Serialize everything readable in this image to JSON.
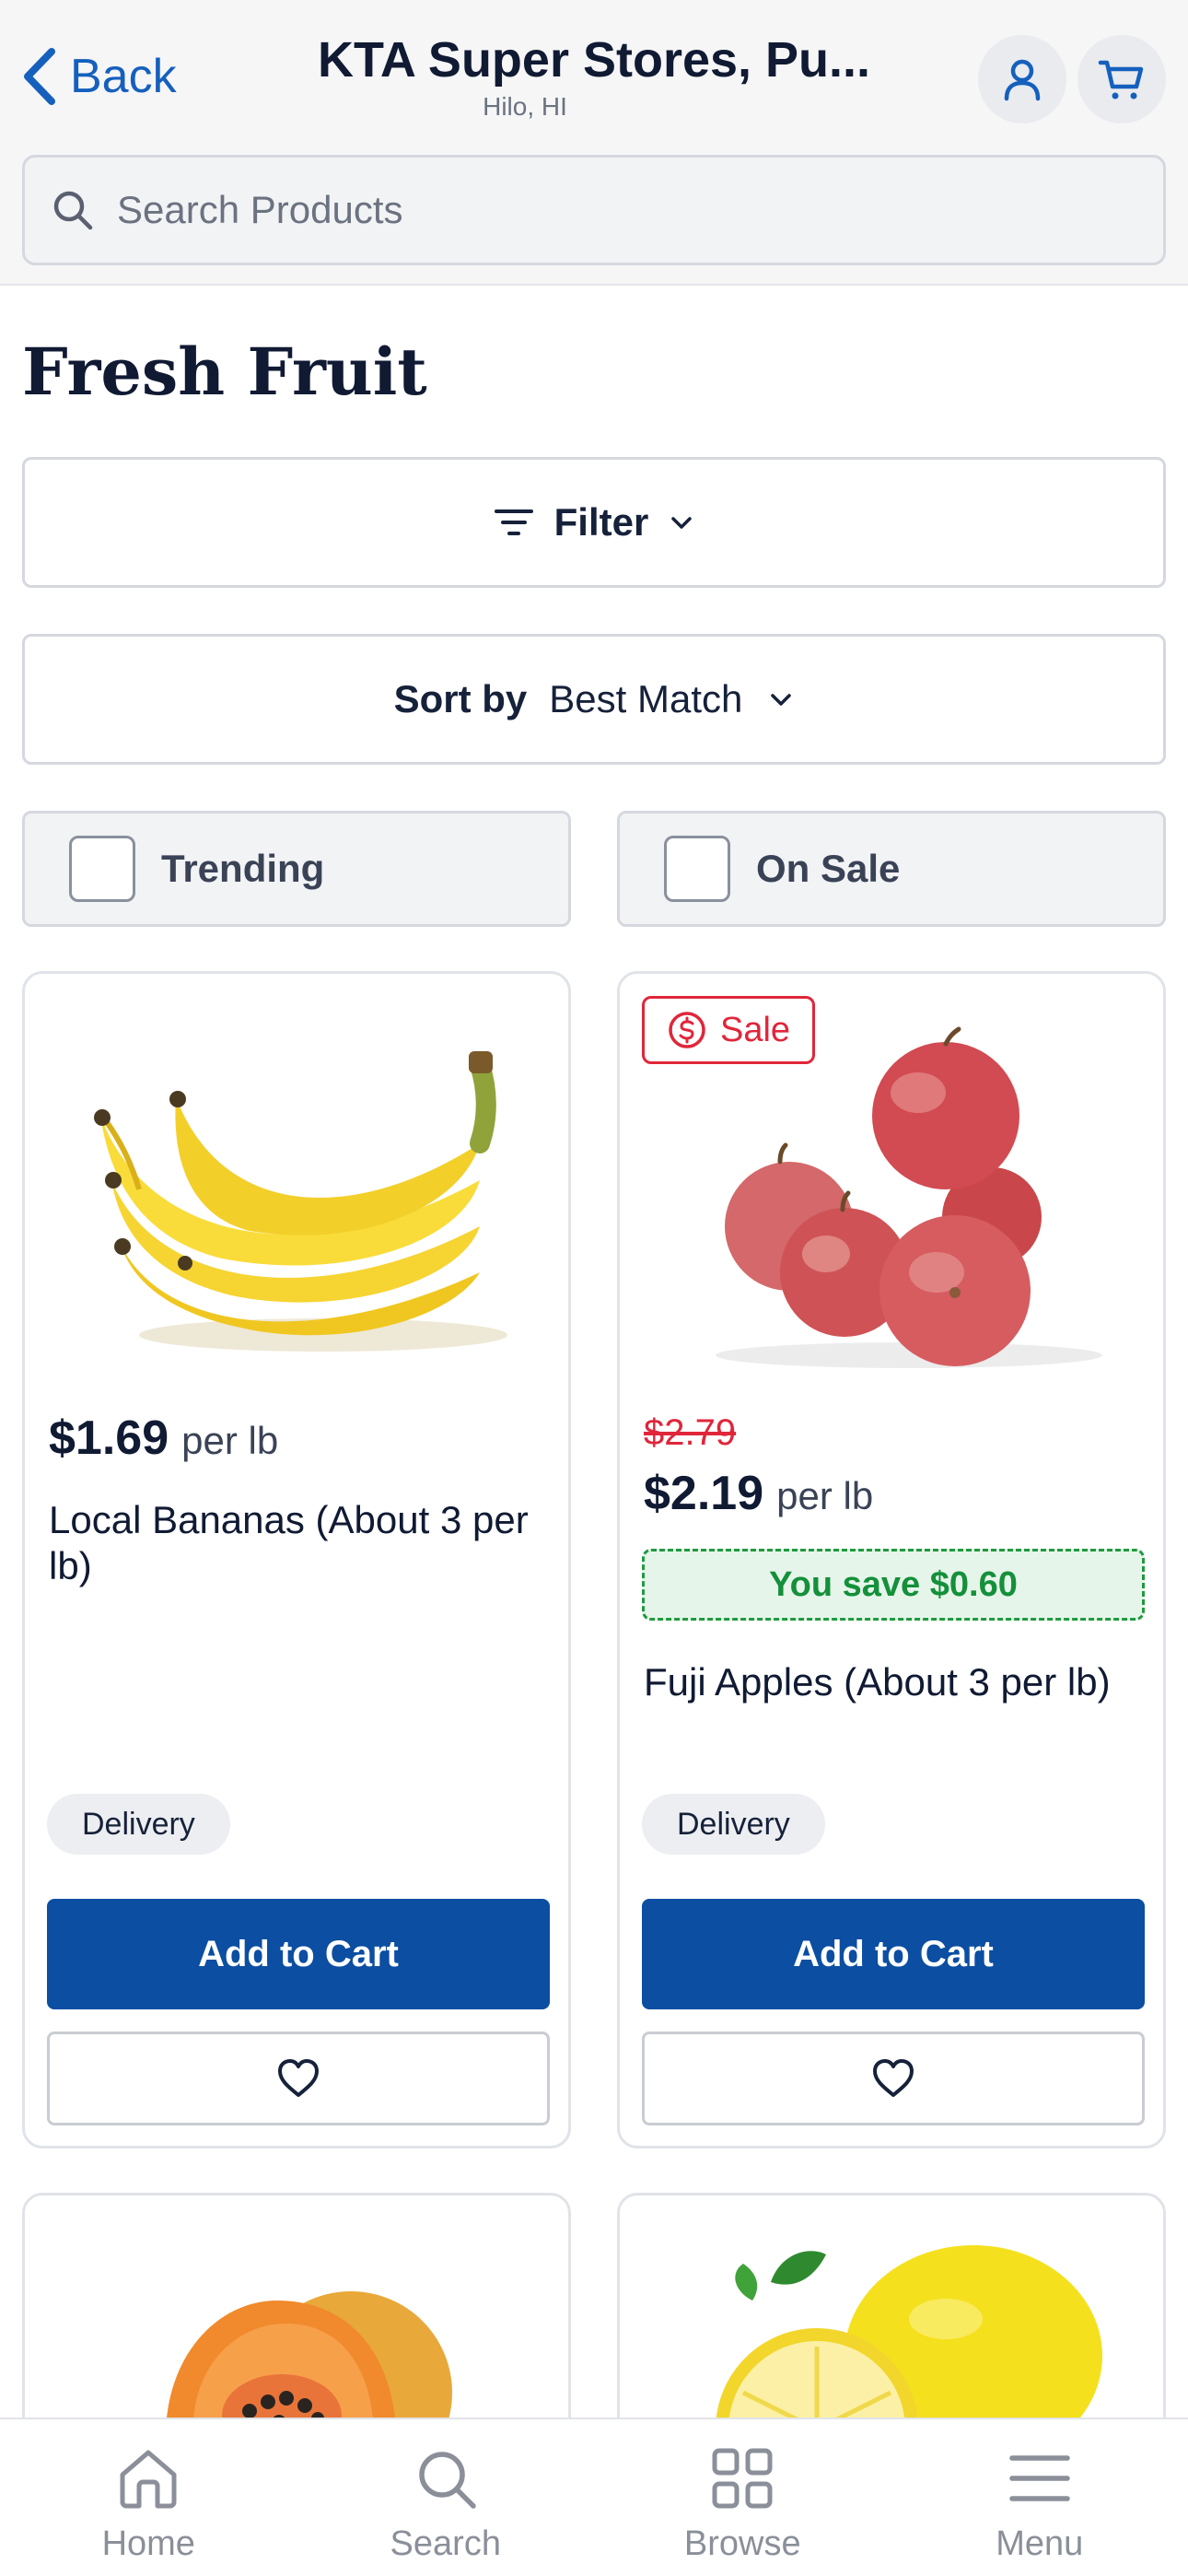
{
  "header": {
    "back_label": "Back",
    "store_name": "KTA Super Stores, Pu...",
    "store_location": "Hilo, HI",
    "account_icon": "user-icon",
    "cart_icon": "cart-icon"
  },
  "search": {
    "placeholder": "Search Products",
    "value": ""
  },
  "page": {
    "title": "Fresh Fruit"
  },
  "filter": {
    "label": "Filter"
  },
  "sort": {
    "label": "Sort by",
    "value": "Best Match"
  },
  "toggles": [
    {
      "label": "Trending",
      "checked": false
    },
    {
      "label": "On Sale",
      "checked": false
    }
  ],
  "products": [
    {
      "name": "Local Bananas (About 3 per lb)",
      "price": "$1.69",
      "unit": "per lb",
      "fulfillment": "Delivery",
      "add_label": "Add to Cart"
    },
    {
      "badge": "Sale",
      "old_price": "$2.79",
      "name": "Fuji Apples (About 3 per lb)",
      "price": "$2.19",
      "unit": "per lb",
      "savings": "You save $0.60",
      "fulfillment": "Delivery",
      "add_label": "Add to Cart"
    }
  ],
  "bottom_nav": [
    {
      "label": "Home",
      "icon": "home-icon"
    },
    {
      "label": "Search",
      "icon": "search-icon"
    },
    {
      "label": "Browse",
      "icon": "grid-icon"
    },
    {
      "label": "Menu",
      "icon": "menu-icon"
    }
  ],
  "colors": {
    "accent": "#1560bd",
    "button": "#0b4ea2",
    "sale": "#e0263a",
    "savings": "#14903a"
  }
}
